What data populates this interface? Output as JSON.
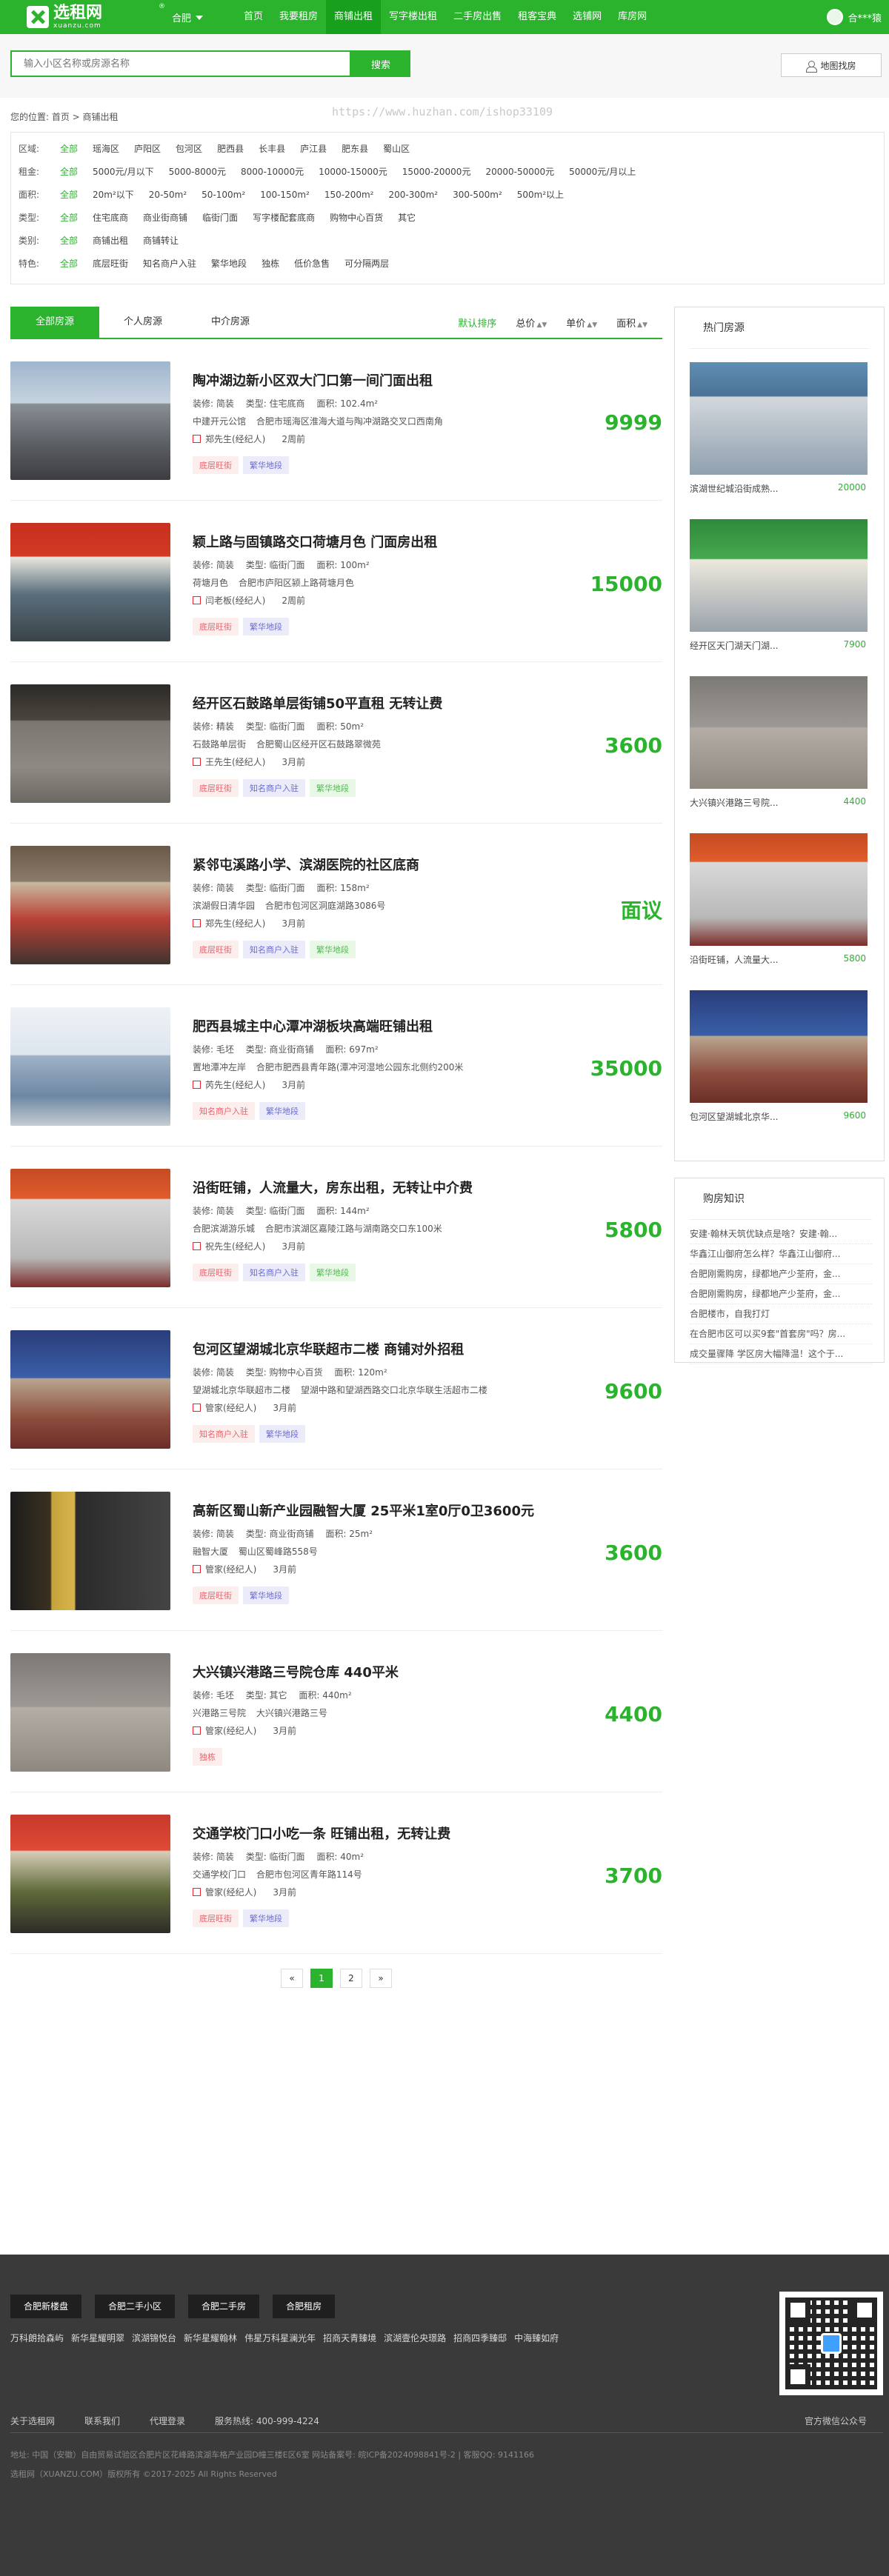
{
  "header": {
    "logo_name": "选租网",
    "logo_domain": "xuanzu.com",
    "logo_reg": "®",
    "city": "合肥",
    "nav": [
      "首页",
      "我要租房",
      "商铺出租",
      "写字楼出租",
      "二手房出售",
      "租客宝典",
      "选铺网",
      "库房网"
    ],
    "active_nav": "商铺出租",
    "user": "合***猿"
  },
  "search": {
    "placeholder": "输入小区名称或房源名称",
    "button": "搜索",
    "map_button": "地图找房"
  },
  "breadcrumb": "您的位置:  首页 > 商铺出租",
  "watermark": "https://www.huzhan.com/ishop33109",
  "filters": [
    {
      "label": "区域:",
      "options": [
        "全部",
        "瑶海区",
        "庐阳区",
        "包河区",
        "肥西县",
        "长丰县",
        "庐江县",
        "肥东县",
        "蜀山区"
      ]
    },
    {
      "label": "租金:",
      "options": [
        "全部",
        "5000元/月以下",
        "5000-8000元",
        "8000-10000元",
        "10000-15000元",
        "15000-20000元",
        "20000-50000元",
        "50000元/月以上"
      ]
    },
    {
      "label": "面积:",
      "options": [
        "全部",
        "20m²以下",
        "20-50m²",
        "50-100m²",
        "100-150m²",
        "150-200m²",
        "200-300m²",
        "300-500m²",
        "500m²以上"
      ]
    },
    {
      "label": "类型:",
      "options": [
        "全部",
        "住宅底商",
        "商业街商铺",
        "临街门面",
        "写字楼配套底商",
        "购物中心百货",
        "其它"
      ]
    },
    {
      "label": "类别:",
      "options": [
        "全部",
        "商铺出租",
        "商铺转让"
      ]
    },
    {
      "label": "特色:",
      "options": [
        "全部",
        "底层旺街",
        "知名商户入驻",
        "繁华地段",
        "独栋",
        "低价急售",
        "可分隔两层"
      ]
    }
  ],
  "tabs": [
    "全部房源",
    "个人房源",
    "中介房源"
  ],
  "sorts": [
    "默认排序",
    "总价",
    "单价",
    "面积"
  ],
  "listings": [
    {
      "title": "陶冲湖边新小区双大门口第一间门面出租",
      "decor": "装修: 简装",
      "type": "类型: 住宅底商",
      "area": "面积: 102.4m²",
      "estate": "中建开元公馆",
      "addr": "合肥市瑶海区淮海大道与陶冲湖路交叉口西南角",
      "agent": "郑先生(经纪人)",
      "time": "2周前",
      "tags": [
        [
          "底层旺街",
          "red"
        ],
        [
          "繁华地段",
          "blue"
        ]
      ],
      "price": "9999"
    },
    {
      "title": "颖上路与固镇路交口荷塘月色 门面房出租",
      "decor": "装修: 简装",
      "type": "类型: 临街门面",
      "area": "面积: 100m²",
      "estate": "荷塘月色",
      "addr": "合肥市庐阳区颍上路荷塘月色",
      "agent": "闫老板(经纪人)",
      "time": "2周前",
      "tags": [
        [
          "底层旺街",
          "red"
        ],
        [
          "繁华地段",
          "blue"
        ]
      ],
      "price": "15000"
    },
    {
      "title": "经开区石鼓路单层街铺50平直租 无转让费",
      "decor": "装修: 精装",
      "type": "类型: 临街门面",
      "area": "面积: 50m²",
      "estate": "石鼓路单层街",
      "addr": "合肥蜀山区经开区石鼓路翠微苑",
      "agent": "王先生(经纪人)",
      "time": "3月前",
      "tags": [
        [
          "底层旺街",
          "red"
        ],
        [
          "知名商户入驻",
          "blue"
        ],
        [
          "繁华地段",
          "green"
        ]
      ],
      "price": "3600"
    },
    {
      "title": "紧邻屯溪路小学、滨湖医院的社区底商",
      "decor": "装修: 简装",
      "type": "类型: 临街门面",
      "area": "面积: 158m²",
      "estate": "滨湖假日清华园",
      "addr": "合肥市包河区洞庭湖路3086号",
      "agent": "郑先生(经纪人)",
      "time": "3月前",
      "tags": [
        [
          "底层旺街",
          "red"
        ],
        [
          "知名商户入驻",
          "blue"
        ],
        [
          "繁华地段",
          "green"
        ]
      ],
      "price": "面议"
    },
    {
      "title": "肥西县城主中心潭冲湖板块高端旺铺出租",
      "decor": "装修: 毛坯",
      "type": "类型: 商业街商铺",
      "area": "面积: 697m²",
      "estate": "置地潭冲左岸",
      "addr": "合肥市肥西县青年路(潭冲河湿地公园东北侧约200米",
      "agent": "芮先生(经纪人)",
      "time": "3月前",
      "tags": [
        [
          "知名商户入驻",
          "red"
        ],
        [
          "繁华地段",
          "blue"
        ]
      ],
      "price": "35000"
    },
    {
      "title": "沿街旺铺，人流量大，房东出租，无转让中介费",
      "decor": "装修: 简装",
      "type": "类型: 临街门面",
      "area": "面积: 144m²",
      "estate": "合肥滨湖游乐城",
      "addr": "合肥市滨湖区嘉陵江路与湖南路交口东100米",
      "agent": "祝先生(经纪人)",
      "time": "3月前",
      "tags": [
        [
          "底层旺街",
          "red"
        ],
        [
          "知名商户入驻",
          "blue"
        ],
        [
          "繁华地段",
          "green"
        ]
      ],
      "price": "5800"
    },
    {
      "title": "包河区望湖城北京华联超市二楼 商铺对外招租",
      "decor": "装修: 简装",
      "type": "类型: 购物中心百货",
      "area": "面积: 120m²",
      "estate": "望湖城北京华联超市二楼",
      "addr": "望湖中路和望湖西路交口北京华联生活超市二楼",
      "agent": "管家(经纪人)",
      "time": "3月前",
      "tags": [
        [
          "知名商户入驻",
          "red"
        ],
        [
          "繁华地段",
          "blue"
        ]
      ],
      "price": "9600"
    },
    {
      "title": "高新区蜀山新产业园融智大厦 25平米1室0厅0卫3600元",
      "decor": "装修: 简装",
      "type": "类型: 商业街商铺",
      "area": "面积: 25m²",
      "estate": "融智大厦",
      "addr": "蜀山区蜀峰路558号",
      "agent": "管家(经纪人)",
      "time": "3月前",
      "tags": [
        [
          "底层旺街",
          "red"
        ],
        [
          "繁华地段",
          "blue"
        ]
      ],
      "price": "3600"
    },
    {
      "title": "大兴镇兴港路三号院仓库 440平米",
      "decor": "装修: 毛坯",
      "type": "类型: 其它",
      "area": "面积: 440m²",
      "estate": "兴港路三号院",
      "addr": "大兴镇兴港路三号",
      "agent": "管家(经纪人)",
      "time": "3月前",
      "tags": [
        [
          "独栋",
          "red"
        ]
      ],
      "price": "4400"
    },
    {
      "title": "交通学校门口小吃一条 旺铺出租，无转让费",
      "decor": "装修: 简装",
      "type": "类型: 临街门面",
      "area": "面积: 40m²",
      "estate": "交通学校门口",
      "addr": "合肥市包河区青年路114号",
      "agent": "管家(经纪人)",
      "time": "3月前",
      "tags": [
        [
          "底层旺街",
          "red"
        ],
        [
          "繁华地段",
          "blue"
        ]
      ],
      "price": "3700"
    }
  ],
  "pager": [
    "«",
    "1",
    "2",
    "»"
  ],
  "sidebar": {
    "hot_title": "热门房源",
    "hot": [
      {
        "name": "滨湖世纪城沿街成熟...",
        "price": "20000"
      },
      {
        "name": "经开区天门湖天门湖...",
        "price": "7900"
      },
      {
        "name": "大兴镇兴港路三号院...",
        "price": "4400"
      },
      {
        "name": "沿街旺铺，人流量大...",
        "price": "5800"
      },
      {
        "name": "包河区望湖城北京华...",
        "price": "9600"
      }
    ],
    "knowledge_title": "购房知识",
    "knowledge": [
      "安建·翰林天筑优缺点是啥？安建·翰...",
      "华鑫江山御府怎么样？华鑫江山御府...",
      "合肥刚需购房，绿都地产少荃府，金...",
      "合肥刚需购房，绿都地产少荃府，金...",
      "合肥楼市，自我打灯",
      "在合肥市区可以买9套\"首套房\"吗？房...",
      "成交量骤降 学区房大幅降温！这个于..."
    ]
  },
  "footer": {
    "buttons": [
      "合肥新楼盘",
      "合肥二手小区",
      "合肥二手房",
      "合肥租房"
    ],
    "links": [
      "万科朗拾森屿",
      "新华星耀明翠",
      "滨湖锦悦台",
      "新华星耀翰林",
      "伟星万科星澜光年",
      "招商天青臻境",
      "滨湖壹伦央璟路",
      "招商四季臻邸",
      "中海臻如府"
    ],
    "bottom_links": [
      "关于选租网",
      "联系我们",
      "代理登录",
      "服务热线: 400-999-4224"
    ],
    "wechat": "官方微信公众号",
    "address": "地址: 中国（安徽）自由贸易试验区合肥片区花峰路滨湖车格产业园D幢三楼E区6室 网站备案号: 皖ICP备2024098841号-2  | 客服QQ: 9141166",
    "copyright": "选租网（XUANZU.COM）版权所有 ©2017-2025 All Rights Reserved"
  }
}
